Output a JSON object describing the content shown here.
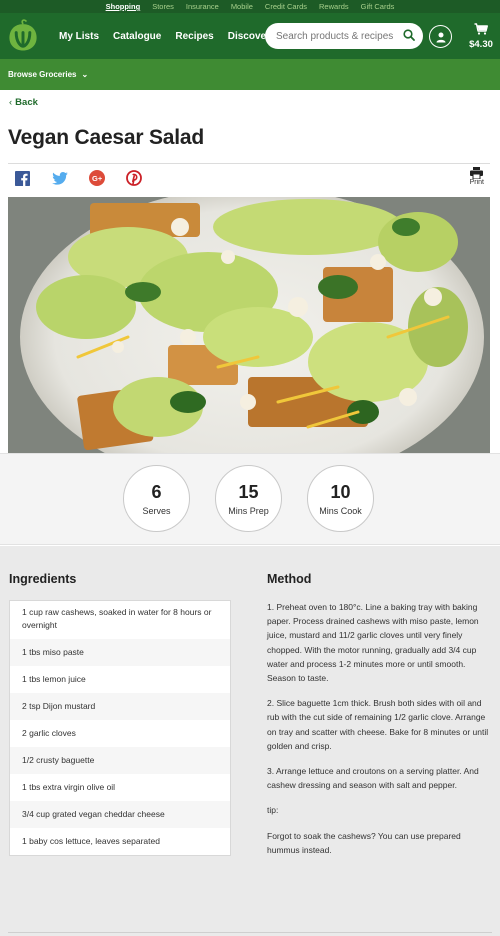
{
  "topbar": [
    "Shopping",
    "Stores",
    "Insurance",
    "Mobile",
    "Credit Cards",
    "Rewards",
    "Gift Cards"
  ],
  "nav": [
    "My Lists",
    "Catalogue",
    "Recipes",
    "Discover"
  ],
  "search": {
    "placeholder": "Search products & recipes"
  },
  "cart": {
    "amount": "$4.30"
  },
  "browse": {
    "label": "Browse Groceries"
  },
  "back": {
    "label": "Back"
  },
  "recipe": {
    "title": "Vegan Caesar Salad",
    "print_label": "Print"
  },
  "stats": [
    {
      "value": "6",
      "label": "Serves"
    },
    {
      "value": "15",
      "label": "Mins Prep"
    },
    {
      "value": "10",
      "label": "Mins Cook"
    }
  ],
  "ingredients": {
    "heading": "Ingredients",
    "items": [
      "1 cup raw cashews, soaked in water for 8 hours or overnight",
      "1 tbs miso paste",
      "1 tbs lemon juice",
      "2 tsp Dijon mustard",
      "2 garlic cloves",
      "1/2 crusty baguette",
      "1 tbs extra virgin olive oil",
      "3/4 cup grated vegan cheddar cheese",
      "1 baby cos lettuce, leaves separated"
    ]
  },
  "method": {
    "heading": "Method",
    "steps": [
      "1. Preheat oven to 180°c. Line a baking tray with baking paper. Process drained cashews with miso paste, lemon juice, mustard and 11/2 garlic cloves until very finely chopped. With the motor running, gradually add 3/4 cup water and process 1-2 minutes more or until smooth. Season to taste.",
      "2. Slice baguette 1cm thick. Brush both sides with oil and rub with the cut side of remaining 1/2 garlic clove. Arrange on tray and scatter with cheese. Bake for 8 minutes or until golden and crisp.",
      "3. Arrange lettuce and croutons on a serving platter. And cashew dressing and season with salt and pepper.",
      "tip:",
      "Forgot to soak the cashews? You can use prepared hummus instead."
    ]
  },
  "colors": {
    "brand_dark": "#1f6a2b",
    "brand_bar": "#3f8b33",
    "facebook": "#3b5998",
    "twitter": "#55acee",
    "google": "#dd4b39",
    "pinterest": "#cb2027"
  }
}
